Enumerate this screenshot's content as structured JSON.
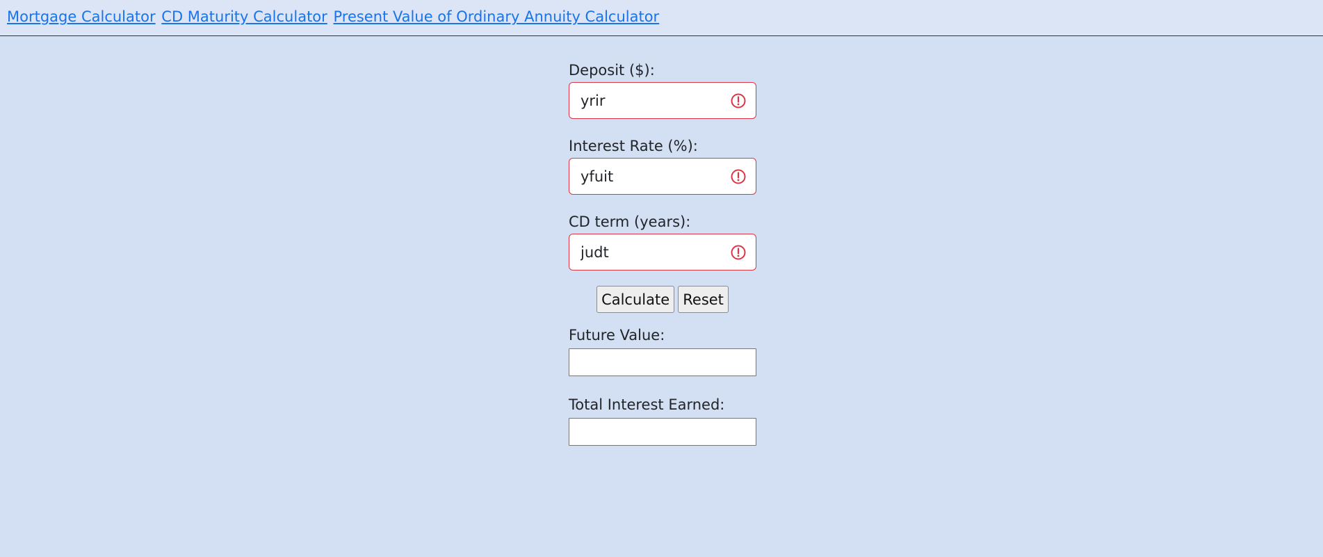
{
  "nav": {
    "links": [
      {
        "label": "Mortgage Calculator"
      },
      {
        "label": "CD Maturity Calculator"
      },
      {
        "label": "Present Value of Ordinary Annuity Calculator"
      }
    ]
  },
  "form": {
    "deposit": {
      "label": "Deposit ($):",
      "value": "yrir",
      "state": "invalid"
    },
    "interest_rate": {
      "label": "Interest Rate (%):",
      "value": "yfuit",
      "state": "invalid"
    },
    "cd_term": {
      "label": "CD term (years):",
      "value": "judt",
      "state": "invalid"
    },
    "calculate_label": "Calculate",
    "reset_label": "Reset"
  },
  "results": {
    "future_value": {
      "label": "Future Value:",
      "value": ""
    },
    "total_interest": {
      "label": "Total Interest Earned:",
      "value": ""
    }
  },
  "icons": {
    "invalid_field": "exclamation-circle-icon"
  },
  "colors": {
    "background": "#d3dff2",
    "link": "#1a73e8",
    "error": "#dc3545"
  }
}
